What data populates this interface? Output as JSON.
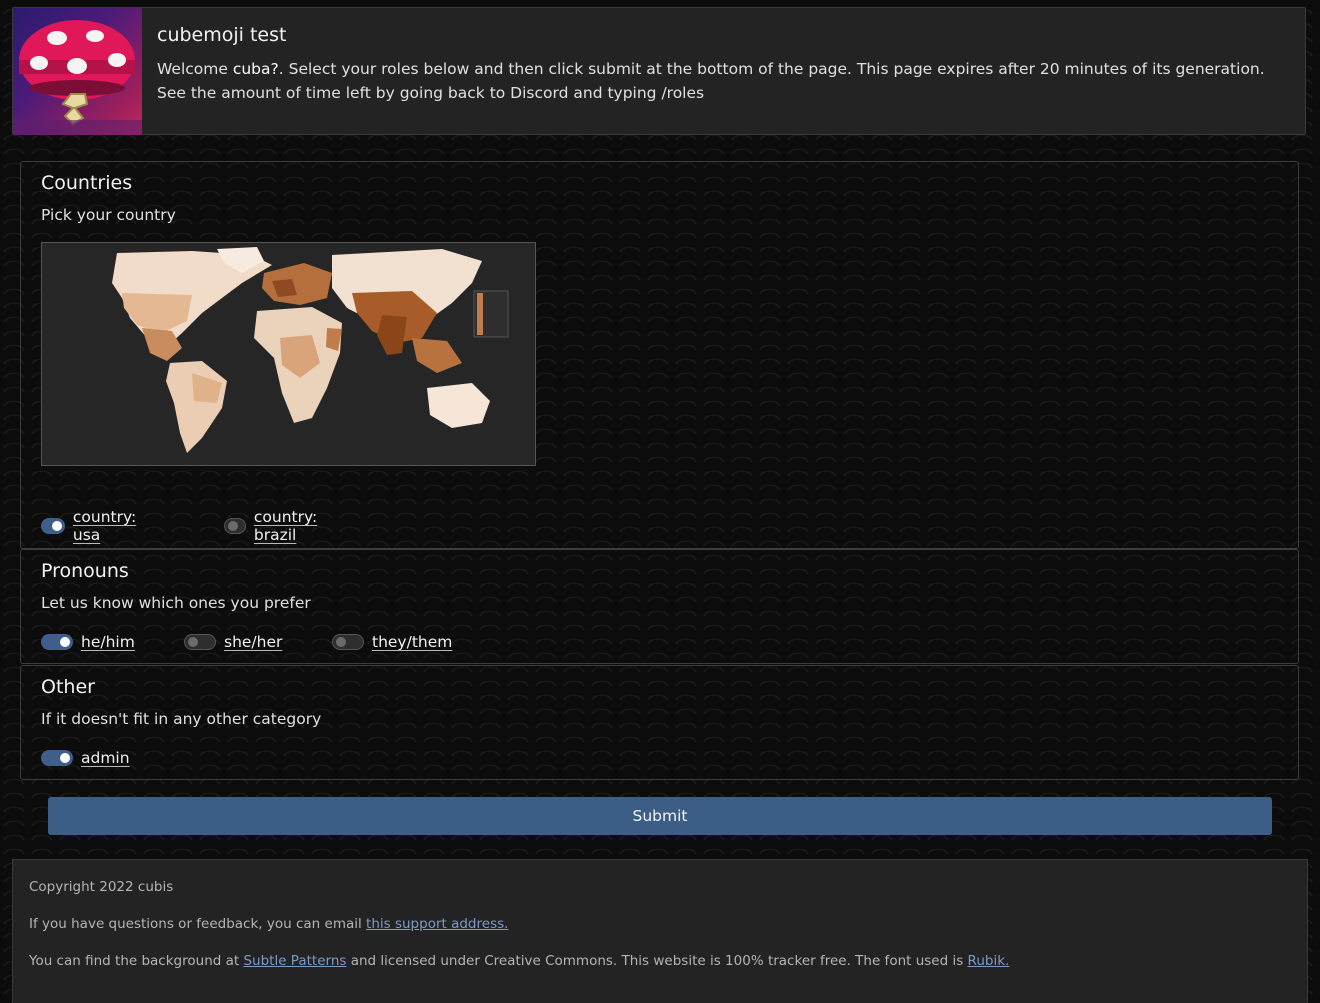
{
  "header": {
    "title": "cubemoji test",
    "welcome_prefix": "Welcome ",
    "username": "cuba?",
    "welcome_suffix": ". Select your roles below and then click submit at the bottom of the page. This page expires after 20 minutes of its generation. See the amount of time left by going back to Discord and typing /roles"
  },
  "sections": [
    {
      "title": "Countries",
      "description": "Pick your country",
      "roles": [
        {
          "label": "country: usa",
          "checked": true
        },
        {
          "label": "country: brazil",
          "checked": false
        }
      ]
    },
    {
      "title": "Pronouns",
      "description": "Let us know which ones you prefer",
      "roles": [
        {
          "label": "he/him",
          "checked": true
        },
        {
          "label": "she/her",
          "checked": false
        },
        {
          "label": "they/them",
          "checked": false
        }
      ]
    },
    {
      "title": "Other",
      "description": "If it doesn't fit in any other category",
      "roles": [
        {
          "label": "admin",
          "checked": true
        }
      ]
    }
  ],
  "submit_label": "Submit",
  "footer": {
    "copyright": "Copyright 2022 cubis",
    "contact_prefix": "If you have questions or feedback, you can email ",
    "contact_link": "this support address.",
    "bg_prefix": "You can find the background at ",
    "bg_link": "Subtle Patterns",
    "bg_middle": " and licensed under Creative Commons. This website is 100% tracker free. The font used is ",
    "font_link": "Rubik."
  },
  "colors": {
    "accent": "#3b5d86",
    "card": "#232323",
    "link": "#7d9bc6"
  }
}
